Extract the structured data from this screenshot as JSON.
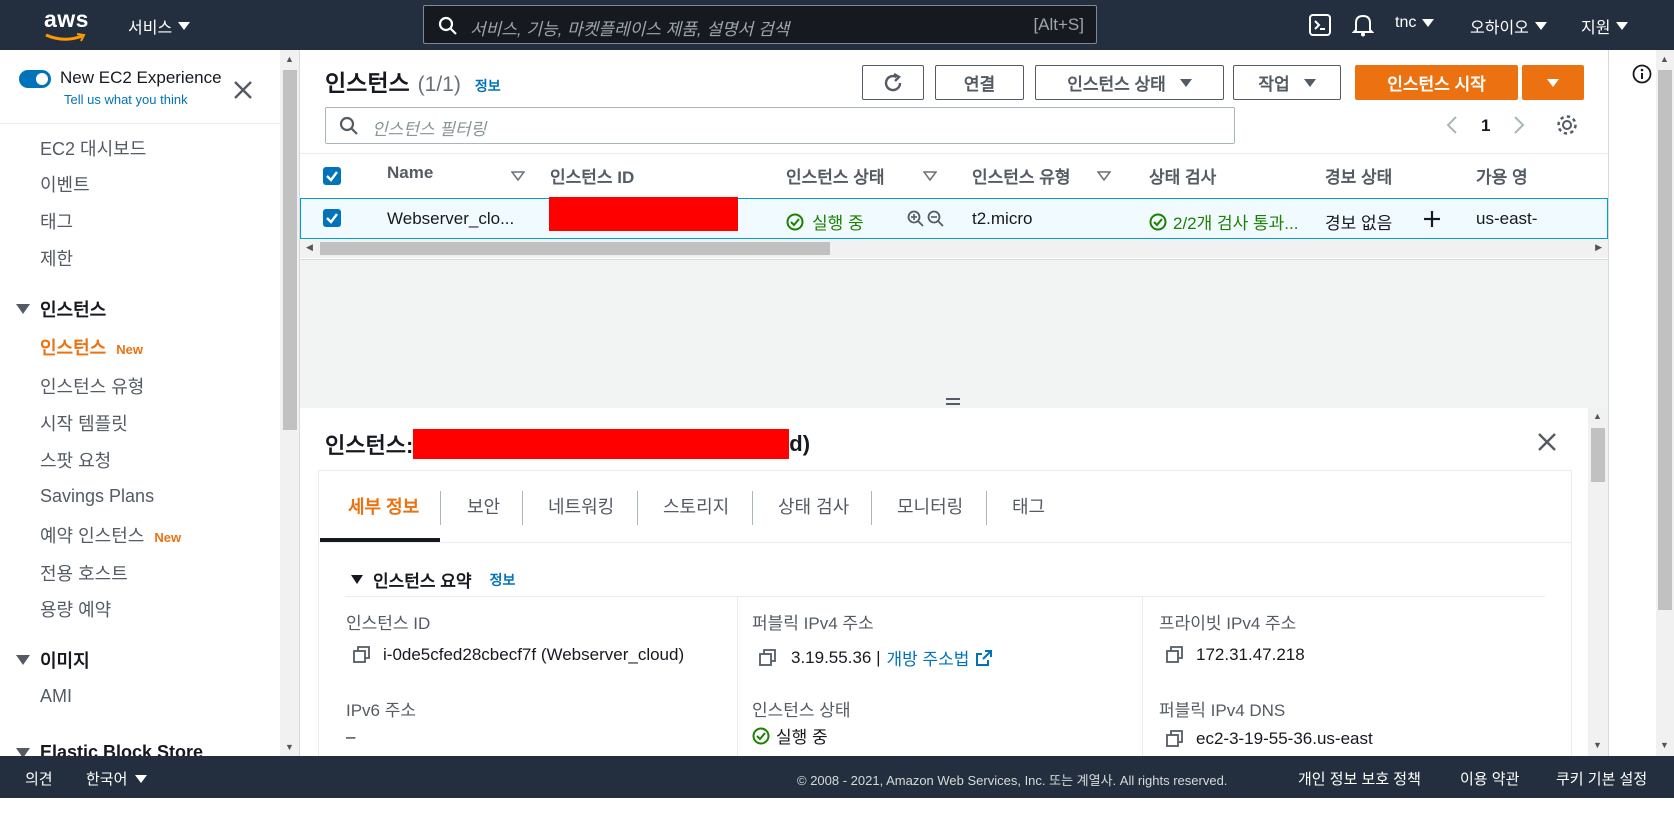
{
  "topbar": {
    "logo": "aws",
    "services": "서비스",
    "search_placeholder": "서비스, 기능, 마켓플레이스 제품, 설명서 검색",
    "search_shortcut": "[Alt+S]",
    "user": "tnc",
    "region": "오하이오",
    "support": "지원"
  },
  "sidebar": {
    "experience_label": "New EC2 Experience",
    "feedback_link": "Tell us what you think",
    "items": [
      {
        "label": "EC2 대시보드"
      },
      {
        "label": "이벤트"
      },
      {
        "label": "태그"
      },
      {
        "label": "제한"
      }
    ],
    "section_instances": "인스턴스",
    "instances_items": [
      {
        "label": "인스턴스",
        "badge": "New"
      },
      {
        "label": "인스턴스 유형"
      },
      {
        "label": "시작 템플릿"
      },
      {
        "label": "스팟 요청"
      },
      {
        "label": "Savings Plans"
      },
      {
        "label": "예약 인스턴스",
        "badge": "New"
      },
      {
        "label": "전용 호스트"
      },
      {
        "label": "용량 예약"
      }
    ],
    "section_images": "이미지",
    "images_items": [
      {
        "label": "AMI"
      }
    ],
    "section_ebs": "Elastic Block Store"
  },
  "instances_panel": {
    "title": "인스턴스",
    "count": "(1/1)",
    "info_link": "정보",
    "connect": "연결",
    "instance_state": "인스턴스 상태",
    "actions": "작업",
    "launch": "인스턴스 시작",
    "filter_placeholder": "인스턴스 필터링",
    "page": "1",
    "columns": [
      "Name",
      "인스턴스 ID",
      "인스턴스 상태",
      "인스턴스 유형",
      "상태 검사",
      "경보 상태",
      "가용 영"
    ],
    "row": {
      "name": "Webserver_clo...",
      "state": "실행 중",
      "type": "t2.micro",
      "checks": "2/2개 검사 통과...",
      "alarm": "경보 없음",
      "az": "us-east-"
    }
  },
  "details": {
    "title_prefix": "인스턴스:",
    "title_suffix": "d)",
    "tabs": [
      "세부 정보",
      "보안",
      "네트워킹",
      "스토리지",
      "상태 검사",
      "모니터링",
      "태그"
    ],
    "summary_title": "인스턴스 요약",
    "summary_info": "정보",
    "fields": {
      "instance_id_label": "인스턴스 ID",
      "instance_id_value": "i-0de5cfed28cbecf7f (Webserver_cloud)",
      "public_ipv4_label": "퍼블릭 IPv4 주소",
      "public_ipv4_value": "3.19.55.36 |",
      "open_address_link": "개방 주소법",
      "private_ipv4_label": "프라이빗 IPv4 주소",
      "private_ipv4_value": "172.31.47.218",
      "ipv6_label": "IPv6 주소",
      "ipv6_value": "–",
      "state_label": "인스턴스 상태",
      "state_value": "실행 중",
      "public_dns_label": "퍼블릭 IPv4 DNS",
      "public_dns_value": "ec2-3-19-55-36.us-east"
    }
  },
  "footer": {
    "feedback": "의견",
    "language": "한국어",
    "copyright": "© 2008 - 2021, Amazon Web Services, Inc. 또는 계열사. All rights reserved.",
    "privacy": "개인 정보 보호 정책",
    "terms": "이용 약관",
    "cookies": "쿠키 기본 설정"
  },
  "colors": {
    "topbar": "#232f3e",
    "accent": "#ec7211",
    "link": "#0073bb",
    "success": "#1d8102",
    "redaction": "#ff0000"
  }
}
